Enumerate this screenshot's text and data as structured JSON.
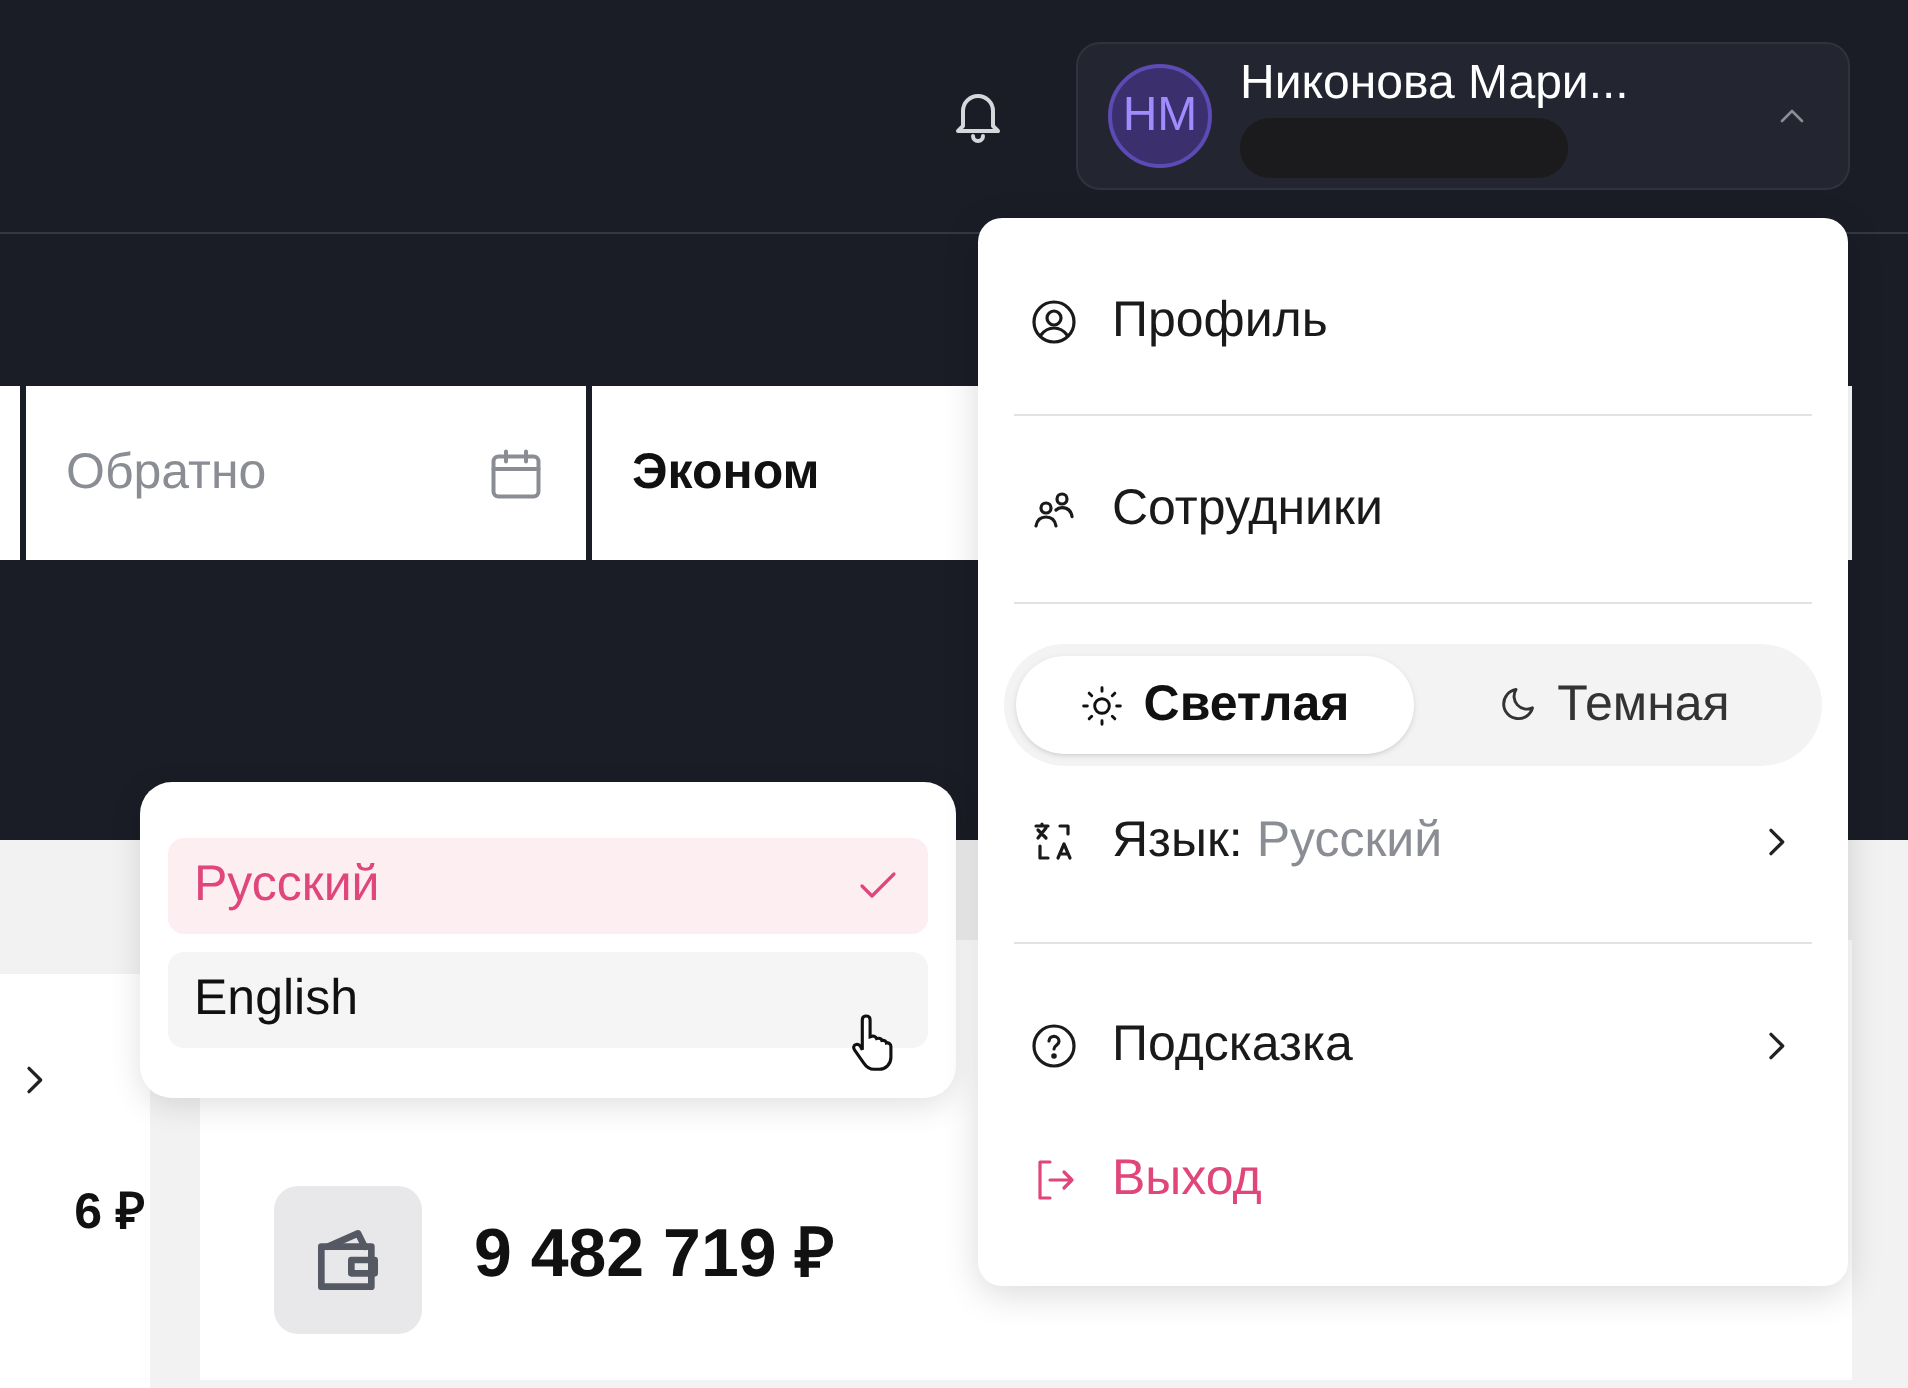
{
  "header": {
    "user": {
      "initials": "НМ",
      "name": "Никонова Мари...",
      "expanded": true
    }
  },
  "search_form": {
    "fields": [
      {
        "kind": "blank"
      },
      {
        "kind": "date",
        "placeholder": "Обратно"
      },
      {
        "kind": "select",
        "value": "Эконом"
      }
    ]
  },
  "cards": [
    {
      "kind": "partial",
      "amount": "6 ₽"
    },
    {
      "kind": "balance",
      "amount": "9 482 719 ₽"
    }
  ],
  "language_menu": {
    "options": [
      {
        "label": "Русский",
        "selected": true
      },
      {
        "label": "English",
        "selected": false
      }
    ]
  },
  "user_menu": {
    "items": [
      {
        "kind": "profile",
        "label": "Профиль",
        "divider_after": true
      },
      {
        "kind": "staff",
        "label": "Сотрудники",
        "divider_after": true
      },
      {
        "kind": "theme",
        "options": [
          {
            "kind": "light",
            "label": "Светлая",
            "selected": true
          },
          {
            "kind": "dark",
            "label": "Темная",
            "selected": false
          }
        ],
        "divider_after": false
      },
      {
        "kind": "language",
        "label": "Язык:",
        "value": "Русский",
        "divider_after": true
      },
      {
        "kind": "help",
        "label": "Подсказка",
        "divider_after": false
      },
      {
        "kind": "logout",
        "label": "Выход",
        "divider_after": false
      }
    ]
  }
}
